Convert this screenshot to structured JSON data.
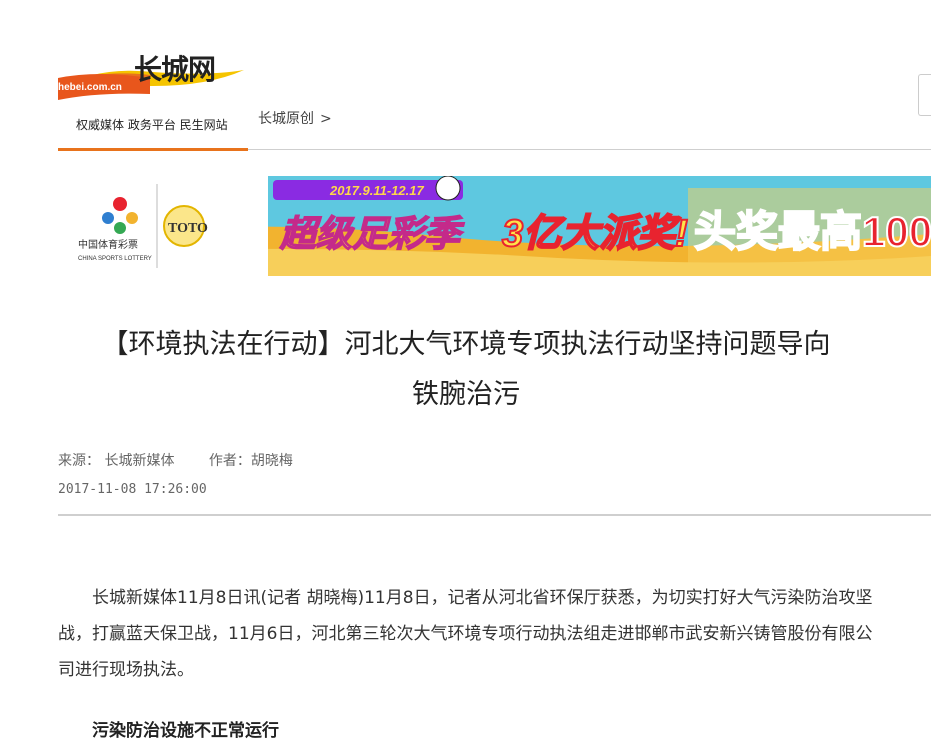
{
  "header": {
    "logo_title": "长城网",
    "logo_domain": "hebei.com.cn",
    "tagline": "权威媒体 政务平台 民生网站",
    "breadcrumb": "长城原创",
    "breadcrumb_sep": ">"
  },
  "banner": {
    "lottery_cn": "中国体育彩票",
    "lottery_en": "CHINA SPORTS LOTTERY",
    "toto": "TOTO",
    "date_range": "2017.9.11-12.17",
    "slogan": "超级足彩季",
    "prize": "3亿大派奖!",
    "jackpot": "头奖最高100",
    "colors": {
      "sky": "#5ec8e0",
      "ground": "#f2b32f",
      "slogan_red": "#e8232f"
    }
  },
  "article": {
    "title_line1": "【环境执法在行动】河北大气环境专项执法行动坚持问题导向",
    "title_line2": "铁腕治污",
    "source_label": "来源：",
    "source": "长城新媒体",
    "author_label": "作者：",
    "author": "胡晓梅",
    "datetime": "2017-11-08 17:26:00",
    "paragraph": "长城新媒体11月8日讯(记者 胡晓梅)11月8日，记者从河北省环保厅获悉，为切实打好大气污染防治攻坚战，打赢蓝天保卫战，11月6日，河北第三轮次大气环境专项行动执法组走进邯郸市武安新兴铸管股份有限公司进行现场执法。",
    "subheading": "污染防治设施不正常运行"
  },
  "colors": {
    "accent": "#e8731c",
    "rule": "#cfcfcf"
  }
}
